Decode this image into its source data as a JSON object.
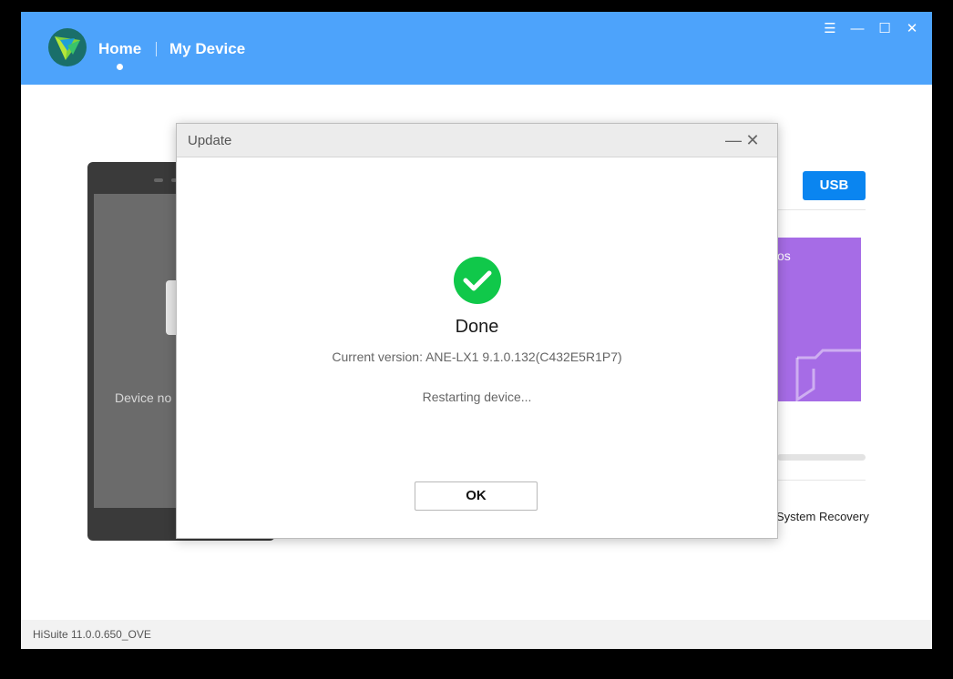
{
  "header": {
    "nav": [
      {
        "label": "Home"
      },
      {
        "label": "My Device"
      }
    ],
    "window_controls": [
      {
        "icon": "menu-icon",
        "glyph": "☰"
      },
      {
        "icon": "minimize-icon",
        "glyph": "—"
      },
      {
        "icon": "maximize-icon",
        "glyph": "☐"
      },
      {
        "icon": "close-icon",
        "glyph": "✕"
      }
    ],
    "accent": "#4da3fb"
  },
  "background": {
    "phone_status": "Device no",
    "usb_label": "USB",
    "card_partial_text": "os",
    "system_recovery_label": "System Recovery",
    "purple_card_color": "#a66ce6"
  },
  "dialog": {
    "title": "Update",
    "minimize_glyph": "—",
    "close_glyph": "✕",
    "status_title": "Done",
    "current_version": "Current version: ANE-LX1 9.1.0.132(C432E5R1P7)",
    "progress_text": "Restarting device...",
    "ok_label": "OK",
    "success_color": "#10c84a"
  },
  "footer": {
    "version": "HiSuite 11.0.0.650_OVE"
  }
}
